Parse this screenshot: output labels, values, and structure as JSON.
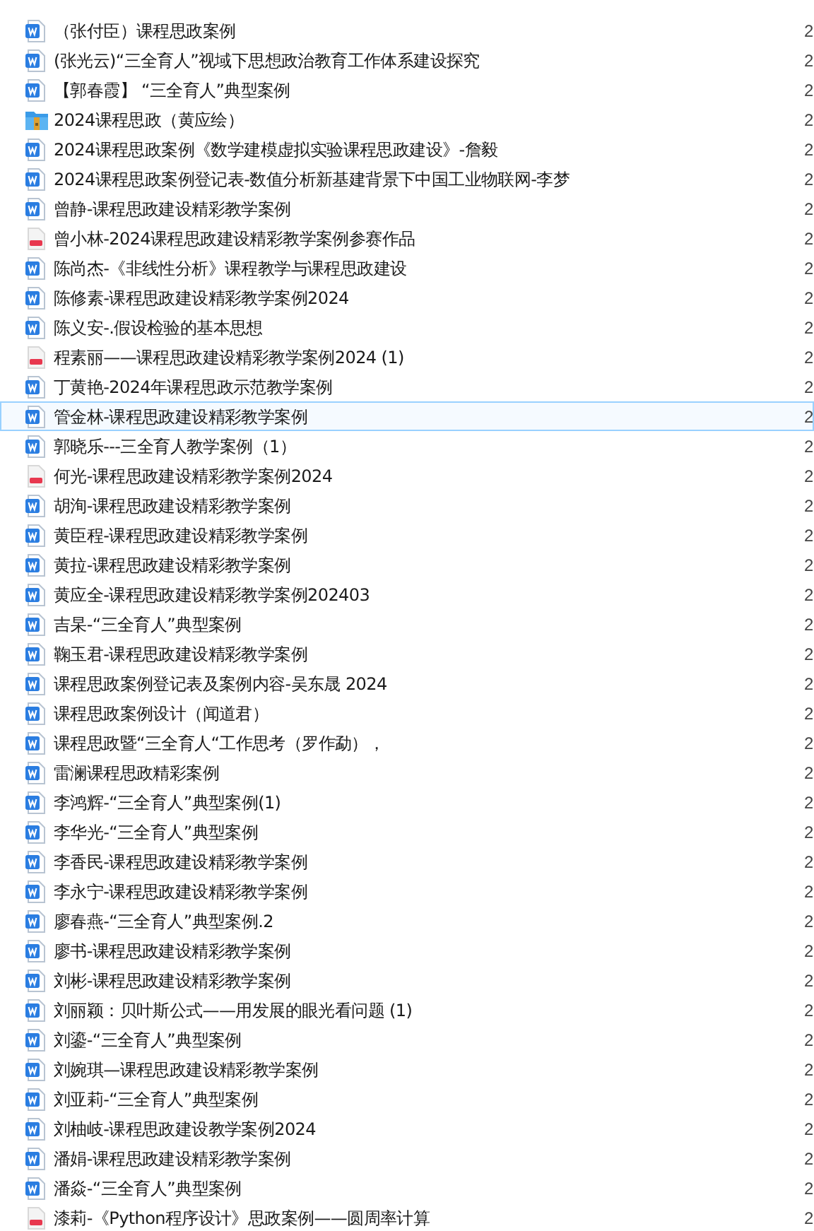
{
  "files": [
    {
      "kind": "word",
      "name": "（张付臣）课程思政案例",
      "column_2": "2",
      "hovered": false
    },
    {
      "kind": "word",
      "name": "(张光云)“三全育人”视域下思想政治教育工作体系建设探究",
      "column_2": "2",
      "hovered": false
    },
    {
      "kind": "word",
      "name": "【郭春霞】 “三全育人”典型案例",
      "column_2": "2",
      "hovered": false
    },
    {
      "kind": "archive",
      "name": "2024课程思政（黄应绘）",
      "column_2": "2",
      "hovered": false
    },
    {
      "kind": "word",
      "name": "2024课程思政案例《数学建模虚拟实验课程思政建设》-詹毅",
      "column_2": "2",
      "hovered": false
    },
    {
      "kind": "word",
      "name": "2024课程思政案例登记表-数值分析新基建背景下中国工业物联网-李梦",
      "column_2": "2",
      "hovered": false
    },
    {
      "kind": "word",
      "name": "曾静-课程思政建设精彩教学案例",
      "column_2": "2",
      "hovered": false
    },
    {
      "kind": "pdf",
      "name": "曾小林-2024课程思政建设精彩教学案例参赛作品",
      "column_2": "2",
      "hovered": false
    },
    {
      "kind": "word",
      "name": "陈尚杰-《非线性分析》课程教学与课程思政建设",
      "column_2": "2",
      "hovered": false
    },
    {
      "kind": "word",
      "name": "陈修素-课程思政建设精彩教学案例2024",
      "column_2": "2",
      "hovered": false
    },
    {
      "kind": "word",
      "name": "陈义安-.假设检验的基本思想",
      "column_2": "2",
      "hovered": false
    },
    {
      "kind": "pdf",
      "name": "程素丽——课程思政建设精彩教学案例2024 (1)",
      "column_2": "2",
      "hovered": false
    },
    {
      "kind": "word",
      "name": "丁黄艳-2024年课程思政示范教学案例",
      "column_2": "2",
      "hovered": false
    },
    {
      "kind": "word",
      "name": "管金林-课程思政建设精彩教学案例",
      "column_2": "2",
      "hovered": true
    },
    {
      "kind": "word",
      "name": "郭晓乐---三全育人教学案例（1）",
      "column_2": "2",
      "hovered": false
    },
    {
      "kind": "pdf",
      "name": "何光-课程思政建设精彩教学案例2024",
      "column_2": "2",
      "hovered": false
    },
    {
      "kind": "word",
      "name": "胡洵-课程思政建设精彩教学案例",
      "column_2": "2",
      "hovered": false
    },
    {
      "kind": "word",
      "name": "黄臣程-课程思政建设精彩教学案例",
      "column_2": "2",
      "hovered": false
    },
    {
      "kind": "word",
      "name": "黄拉-课程思政建设精彩教学案例",
      "column_2": "2",
      "hovered": false
    },
    {
      "kind": "word",
      "name": "黄应全-课程思政建设精彩教学案例202403",
      "column_2": "2",
      "hovered": false
    },
    {
      "kind": "word",
      "name": "吉杲-“三全育人”典型案例",
      "column_2": "2",
      "hovered": false
    },
    {
      "kind": "word",
      "name": "鞠玉君-课程思政建设精彩教学案例",
      "column_2": "2",
      "hovered": false
    },
    {
      "kind": "word",
      "name": "课程思政案例登记表及案例内容-吴东晟 2024",
      "column_2": "2",
      "hovered": false
    },
    {
      "kind": "word",
      "name": "课程思政案例设计（闻道君）",
      "column_2": "2",
      "hovered": false
    },
    {
      "kind": "word",
      "name": "课程思政暨“三全育人“工作思考（罗作勐），",
      "column_2": "2",
      "hovered": false
    },
    {
      "kind": "word",
      "name": "雷澜课程思政精彩案例",
      "column_2": "2",
      "hovered": false
    },
    {
      "kind": "word",
      "name": "李鸿辉-“三全育人”典型案例(1)",
      "column_2": "2",
      "hovered": false
    },
    {
      "kind": "word",
      "name": "李华光-“三全育人”典型案例",
      "column_2": "2",
      "hovered": false
    },
    {
      "kind": "word",
      "name": "李香民-课程思政建设精彩教学案例",
      "column_2": "2",
      "hovered": false
    },
    {
      "kind": "word",
      "name": "李永宁-课程思政建设精彩教学案例",
      "column_2": "2",
      "hovered": false
    },
    {
      "kind": "word",
      "name": "廖春燕-“三全育人”典型案例.2",
      "column_2": "2",
      "hovered": false
    },
    {
      "kind": "word",
      "name": "廖书-课程思政建设精彩教学案例",
      "column_2": "2",
      "hovered": false
    },
    {
      "kind": "word",
      "name": "刘彬-课程思政建设精彩教学案例",
      "column_2": "2",
      "hovered": false
    },
    {
      "kind": "word",
      "name": "刘丽颖：贝叶斯公式——用发展的眼光看问题 (1)",
      "column_2": "2",
      "hovered": false
    },
    {
      "kind": "word",
      "name": "刘鎏-“三全育人”典型案例",
      "column_2": "2",
      "hovered": false
    },
    {
      "kind": "word",
      "name": "刘婉琪—课程思政建设精彩教学案例",
      "column_2": "2",
      "hovered": false
    },
    {
      "kind": "word",
      "name": "刘亚莉-“三全育人”典型案例",
      "column_2": "2",
      "hovered": false
    },
    {
      "kind": "word",
      "name": "刘柚岐-课程思政建设教学案例2024",
      "column_2": "2",
      "hovered": false
    },
    {
      "kind": "word",
      "name": "潘娟-课程思政建设精彩教学案例",
      "column_2": "2",
      "hovered": false
    },
    {
      "kind": "word",
      "name": "潘焱-“三全育人”典型案例",
      "column_2": "2",
      "hovered": false
    },
    {
      "kind": "pdf",
      "name": "漆莉-《Python程序设计》思政案例——圆周率计算",
      "column_2": "2",
      "hovered": false
    }
  ]
}
